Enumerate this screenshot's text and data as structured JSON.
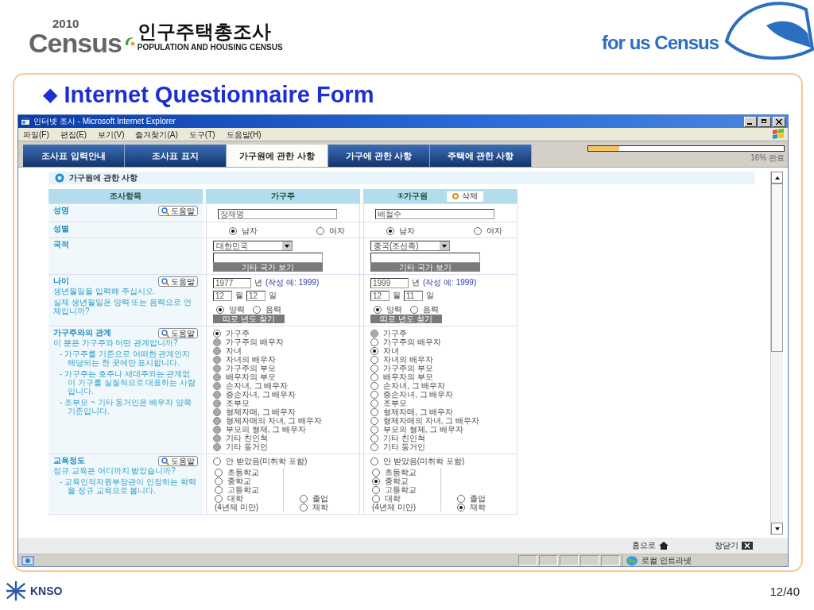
{
  "slide": {
    "logo": {
      "year": "2010",
      "word": "Census",
      "title": "인구주택총조사",
      "subtitle": "POPULATION AND HOUSING CENSUS"
    },
    "slogan": "for us Census",
    "heading_mark": "◆",
    "heading": "Internet Questionnaire Form",
    "footer_logo": "KNSO",
    "page": "12/40"
  },
  "window": {
    "title": "인터넷 조사 - Microsoft Internet Explorer",
    "menu": [
      "파일(F)",
      "편집(E)",
      "보기(V)",
      "즐겨찾기(A)",
      "도구(T)",
      "도움말(H)"
    ],
    "tabs": [
      {
        "label": "조사표 입력안내",
        "selected": false
      },
      {
        "label": "조사표 표지",
        "selected": false
      },
      {
        "label": "가구원에 관한 사항",
        "selected": true
      },
      {
        "label": "가구에 관한 사항",
        "selected": false
      },
      {
        "label": "주택에 관한 사항",
        "selected": false
      }
    ],
    "progress": {
      "level": 0.16,
      "label": "16% 완료"
    },
    "section_title": "가구원에 관한 사항",
    "columns": [
      {
        "label": "조사항목"
      },
      {
        "label": "가구주"
      },
      {
        "label": "①가구원",
        "action": "삭제"
      }
    ],
    "rows": [
      {
        "kind": "text",
        "label": "성명",
        "help": "도움말",
        "answers": [
          {
            "value": "장재명"
          },
          {
            "value": "배철수"
          }
        ]
      },
      {
        "kind": "choice",
        "label": "성별",
        "answers": [
          {
            "options": [
              {
                "label": "남자",
                "selected": true
              },
              {
                "label": "여자",
                "selected": false
              }
            ]
          },
          {
            "options": [
              {
                "label": "남자",
                "selected": true
              },
              {
                "label": "여자",
                "selected": false
              }
            ]
          }
        ]
      },
      {
        "kind": "nationality",
        "label": "국적",
        "answers": [
          {
            "select": "대한민국",
            "button": "기타 국가 보기"
          },
          {
            "select": "중국(조선족)",
            "button": "기타 국가 보기"
          }
        ]
      },
      {
        "kind": "age",
        "label": "나이",
        "help": "도움말",
        "questions": [
          "생년월일을 입력해 주십시오.",
          "실제 생년월일은 양력 또는 음력으로 언제입니까?"
        ],
        "answers": [
          {
            "year": "1977",
            "year_unit": "년",
            "example": "(작성 예: 1999)",
            "month": "12",
            "month_unit": "월",
            "day": "12",
            "day_unit": "일",
            "calendar": [
              {
                "label": "양력",
                "selected": true
              },
              {
                "label": "음력",
                "selected": false
              }
            ],
            "button": "띠로 년도 찾기"
          },
          {
            "year": "1999",
            "year_unit": "년",
            "example": "(작성 예: 1999)",
            "month": "12",
            "month_unit": "월",
            "day": "11",
            "day_unit": "일",
            "calendar": [
              {
                "label": "양력",
                "selected": true
              },
              {
                "label": "음력",
                "selected": false
              }
            ],
            "button": "띠로 년도 찾기"
          }
        ]
      },
      {
        "kind": "relation",
        "label": "가구주와의 관계",
        "help": "도움말",
        "questions": [
          "이 분은 가구주와 어떤 관계입니까?"
        ],
        "notes": [
          "- 가구주를 기준으로 어떠한 관계인지 해당되는 한 곳에만 표시합니다.",
          "- 가구주는 호주나 세대주와는 관계없이 가구를 실질적으로 대표하는 사람입니다.",
          "- 조부모 ~ 기타 동거인은 배우자 양쪽 기준입니다."
        ],
        "answers": [
          {
            "options": [
              {
                "label": "가구주",
                "selected": true,
                "disabled": false
              },
              {
                "label": "가구주의 배우자",
                "selected": false,
                "disabled": true
              },
              {
                "label": "자녀",
                "selected": false,
                "disabled": true
              },
              {
                "label": "자녀의 배우자",
                "selected": false,
                "disabled": true
              },
              {
                "label": "가구주의 부모",
                "selected": false,
                "disabled": true
              },
              {
                "label": "배우자의 부모",
                "selected": false,
                "disabled": true
              },
              {
                "label": "손자녀, 그 배우자",
                "selected": false,
                "disabled": true
              },
              {
                "label": "증손자녀, 그 배우자",
                "selected": false,
                "disabled": true
              },
              {
                "label": "조부모",
                "selected": false,
                "disabled": true
              },
              {
                "label": "형제자매, 그 배우자",
                "selected": false,
                "disabled": true
              },
              {
                "label": "형제자매의 자녀, 그 배우자",
                "selected": false,
                "disabled": true
              },
              {
                "label": "부모의 형제, 그 배우자",
                "selected": false,
                "disabled": true
              },
              {
                "label": "기타 친인척",
                "selected": false,
                "disabled": true
              },
              {
                "label": "기타 동거인",
                "selected": false,
                "disabled": true
              }
            ]
          },
          {
            "options": [
              {
                "label": "가구주",
                "selected": false,
                "disabled": true
              },
              {
                "label": "가구주의 배우자",
                "selected": false,
                "disabled": false
              },
              {
                "label": "자녀",
                "selected": true,
                "disabled": false
              },
              {
                "label": "자녀의 배우자",
                "selected": false,
                "disabled": false
              },
              {
                "label": "가구주의 부모",
                "selected": false,
                "disabled": false
              },
              {
                "label": "배우자의 부모",
                "selected": false,
                "disabled": false
              },
              {
                "label": "손자녀, 그 배우자",
                "selected": false,
                "disabled": false
              },
              {
                "label": "증손자녀, 그 배우자",
                "selected": false,
                "disabled": false
              },
              {
                "label": "조부모",
                "selected": false,
                "disabled": false
              },
              {
                "label": "형제자매, 그 배우자",
                "selected": false,
                "disabled": false
              },
              {
                "label": "형제자매의 자녀, 그 배우자",
                "selected": false,
                "disabled": false
              },
              {
                "label": "부모의 형제, 그 배우자",
                "selected": false,
                "disabled": false
              },
              {
                "label": "기타 친인척",
                "selected": false,
                "disabled": false
              },
              {
                "label": "기타 동거인",
                "selected": false,
                "disabled": false
              }
            ]
          }
        ]
      },
      {
        "kind": "education",
        "label": "교육정도",
        "help": "도움말",
        "questions": [
          "정규 교육은 어디까지 받았습니까?"
        ],
        "notes": [
          "- 교육인적자원부장관이 인정하는 학력을 정규 교육으로 봅니다."
        ],
        "answers": [
          {
            "none": {
              "label": "안 받았음(미취학 포함)",
              "selected": false
            },
            "levels": [
              {
                "label": "초등학교",
                "selected": false
              },
              {
                "label": "중학교",
                "selected": false
              },
              {
                "label": "고등학교",
                "selected": false
              },
              {
                "label": "대학",
                "note": "(4년제 미만)",
                "selected": false
              }
            ],
            "status": [
              {
                "label": "졸업",
                "selected": false
              },
              {
                "label": "재학",
                "selected": false
              }
            ]
          },
          {
            "none": {
              "label": "안 받았음(미취학 포함)",
              "selected": false
            },
            "levels": [
              {
                "label": "초등학교",
                "selected": false
              },
              {
                "label": "중학교",
                "selected": true
              },
              {
                "label": "고등학교",
                "selected": false
              },
              {
                "label": "대학",
                "note": "(4년제 미만)",
                "selected": false
              }
            ],
            "status": [
              {
                "label": "졸업",
                "selected": false
              },
              {
                "label": "재학",
                "selected": true
              }
            ]
          }
        ]
      }
    ],
    "footer_links": [
      {
        "kind": "home",
        "label": "홈으로"
      },
      {
        "kind": "close",
        "label": "창닫기"
      }
    ],
    "status_bar": {
      "zone": "로컬 인트라넷"
    }
  }
}
